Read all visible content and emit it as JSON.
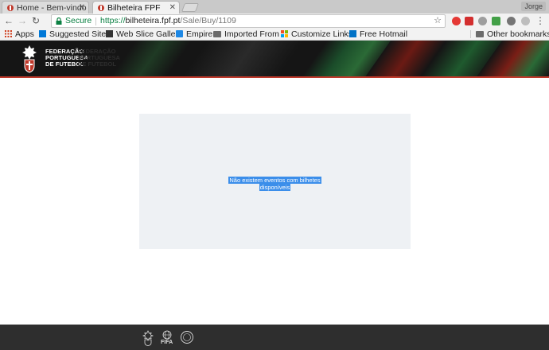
{
  "browser": {
    "tabs": [
      {
        "label": "Home - Bem-vindo à",
        "active": false
      },
      {
        "label": "Bilheteira FPF",
        "active": true
      }
    ],
    "profile": "Jorge",
    "omnibox": {
      "secure_label": "Secure",
      "url_protocol": "https://",
      "url_host": "bilheteira.fpf.pt",
      "url_path": "/Sale/Buy/1109"
    },
    "bookmarks": [
      {
        "label": "Apps",
        "icon": "apps-grid-icon"
      },
      {
        "label": "Suggested Sites",
        "icon": "bing-icon"
      },
      {
        "label": "Web Slice Galler",
        "icon": "web-slice-icon"
      },
      {
        "label": "Empire",
        "icon": "folder-icon"
      },
      {
        "label": "Imported From",
        "icon": "folder-icon"
      },
      {
        "label": "Customize Links",
        "icon": "windows-icon"
      },
      {
        "label": "Free Hotmail",
        "icon": "outlook-icon"
      }
    ],
    "other_bookmarks": "Other bookmarks"
  },
  "site": {
    "org_name_lines": [
      "FEDERAÇÃO",
      "PORTUGUESA",
      "DE FUTEBOL"
    ],
    "message_lines": [
      "Não existem eventos com bilhetes",
      "disponíveis"
    ]
  },
  "footer": {
    "fifa_label": "FIFA"
  },
  "colors": {
    "accent_green": "#0b8043",
    "header_bg": "#151515",
    "header_red": "#c0392b",
    "selection_blue": "#3b8eea",
    "panel_bg": "#eef1f4",
    "footer_bg": "#2e2e2e"
  }
}
